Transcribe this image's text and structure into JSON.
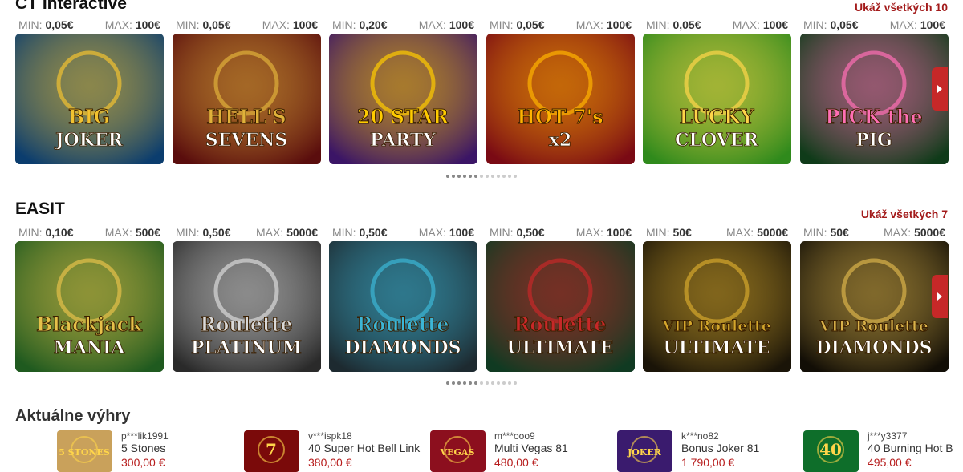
{
  "sections": [
    {
      "title": "CT Interactive",
      "show_all": "Ukáž všetkých 10",
      "games": [
        {
          "min_label": "MIN:",
          "min": "0,05€",
          "max_label": "MAX:",
          "max": "100€",
          "name": "BIG JOKER",
          "bg": "#0b3d6e",
          "accent": "#f2c230"
        },
        {
          "min_label": "MIN:",
          "min": "0,05€",
          "max_label": "MAX:",
          "max": "100€",
          "name": "HELL'S SEVENS",
          "bg": "#5a0d0d",
          "accent": "#e0b13a"
        },
        {
          "min_label": "MIN:",
          "min": "0,20€",
          "max_label": "MAX:",
          "max": "100€",
          "name": "20 STAR PARTY",
          "bg": "#3b1566",
          "accent": "#ffcc00"
        },
        {
          "min_label": "MIN:",
          "min": "0,05€",
          "max_label": "MAX:",
          "max": "100€",
          "name": "HOT 7's x2",
          "bg": "#7a0a14",
          "accent": "#ffb300"
        },
        {
          "min_label": "MIN:",
          "min": "0,05€",
          "max_label": "MAX:",
          "max": "100€",
          "name": "LUCKY CLOVER",
          "bg": "#2f8a1c",
          "accent": "#ffd54a"
        },
        {
          "min_label": "MIN:",
          "min": "0,05€",
          "max_label": "MAX:",
          "max": "100€",
          "name": "PICK the PIG",
          "bg": "#0f3b19",
          "accent": "#ff6fb5"
        }
      ]
    },
    {
      "title": "EASIT",
      "show_all": "Ukáž všetkých 7",
      "games": [
        {
          "min_label": "MIN:",
          "min": "0,10€",
          "max_label": "MAX:",
          "max": "500€",
          "name": "Blackjack MANIA",
          "bg": "#1f5a1f",
          "accent": "#e6c14a"
        },
        {
          "min_label": "MIN:",
          "min": "0,50€",
          "max_label": "MAX:",
          "max": "5000€",
          "name": "Roulette PLATINUM",
          "bg": "#2a2a2a",
          "accent": "#d9d9d9"
        },
        {
          "min_label": "MIN:",
          "min": "0,50€",
          "max_label": "MAX:",
          "max": "100€",
          "name": "Roulette DIAMONDS",
          "bg": "#1d2a30",
          "accent": "#3cb6d6"
        },
        {
          "min_label": "MIN:",
          "min": "0,50€",
          "max_label": "MAX:",
          "max": "100€",
          "name": "Roulette ULTIMATE",
          "bg": "#103a22",
          "accent": "#c62828"
        },
        {
          "min_label": "MIN:",
          "min": "50€",
          "max_label": "MAX:",
          "max": "5000€",
          "name": "VIP Roulette ULTIMATE",
          "bg": "#1a1408",
          "accent": "#d4a72c"
        },
        {
          "min_label": "MIN:",
          "min": "50€",
          "max_label": "MAX:",
          "max": "5000€",
          "name": "VIP Roulette DIAMONDS",
          "bg": "#120e06",
          "accent": "#d9b24a"
        }
      ]
    }
  ],
  "recent_wins": {
    "title": "Aktuálne výhry",
    "items": [
      {
        "user": "p***lik1991",
        "game": "5 Stones",
        "amount": "300,00 €",
        "thumb_bg": "#c9a15b",
        "thumb_text": "5 STONES"
      },
      {
        "user": "v***ispk18",
        "game": "40 Super Hot Bell Link",
        "amount": "380,00 €",
        "thumb_bg": "#7a0a0a",
        "thumb_text": "7"
      },
      {
        "user": "m***ooo9",
        "game": "Multi Vegas 81",
        "amount": "480,00 €",
        "thumb_bg": "#8c0f1e",
        "thumb_text": "VEGAS"
      },
      {
        "user": "k***no82",
        "game": "Bonus Joker 81",
        "amount": "1 790,00 €",
        "thumb_bg": "#3a1b6e",
        "thumb_text": "JOKER"
      },
      {
        "user": "j***y3377",
        "game": "40 Burning Hot B",
        "amount": "495,00 €",
        "thumb_bg": "#0e6e2a",
        "thumb_text": "40"
      }
    ]
  }
}
